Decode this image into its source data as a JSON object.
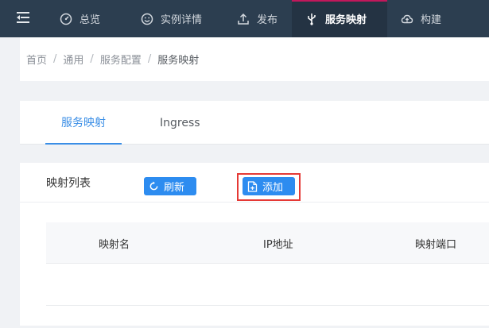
{
  "nav": {
    "tabs": [
      {
        "label": "总览",
        "icon": "dashboard-icon"
      },
      {
        "label": "实例详情",
        "icon": "smile-icon"
      },
      {
        "label": "发布",
        "icon": "upload-icon"
      },
      {
        "label": "服务映射",
        "icon": "usb-icon",
        "active": true
      },
      {
        "label": "构建",
        "icon": "cloud-upload-icon"
      }
    ],
    "colors": {
      "bar": "#2c3e50",
      "active_bg": "#243343",
      "active_accent": "#c2185b"
    }
  },
  "breadcrumb": {
    "items": [
      "首页",
      "通用",
      "服务配置",
      "服务映射"
    ],
    "separator": "/"
  },
  "subtabs": [
    {
      "label": "服务映射",
      "active": true
    },
    {
      "label": "Ingress",
      "active": false
    }
  ],
  "panel": {
    "title": "映射列表",
    "refresh_label": "刷新",
    "add_label": "添加",
    "accent": "#2d8cf0",
    "highlight_color": "#e53935"
  },
  "table": {
    "columns": [
      "映射名",
      "IP地址",
      "映射端口"
    ],
    "rows": []
  }
}
